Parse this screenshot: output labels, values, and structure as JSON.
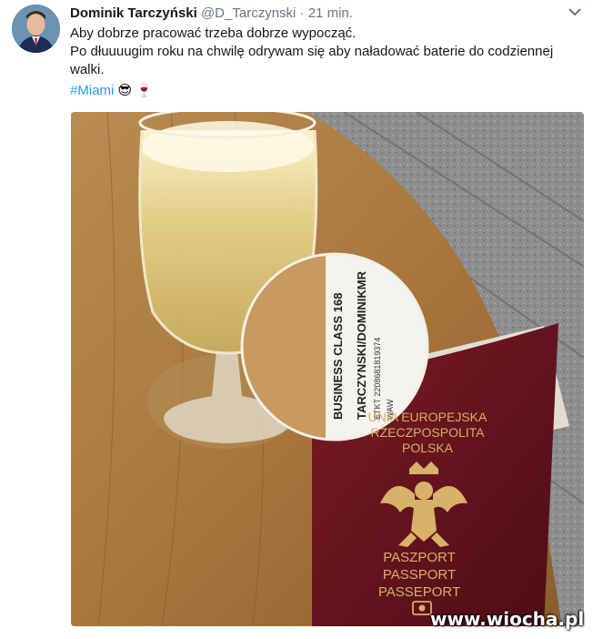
{
  "tweet": {
    "author_name": "Dominik Tarczyński",
    "handle": "@D_Tarczynski",
    "separator": "·",
    "time": "21 min.",
    "text_lines": [
      "Aby dobrze pracować trzeba dobrze wypocząć.",
      "Po dłuuuugim roku na chwilę odrywam się aby naładować baterie do codziennej",
      "walki."
    ],
    "hashtag": "#Miami",
    "emojis": [
      "sunglasses-face-emoji",
      "wine-glass-emoji"
    ]
  },
  "photo": {
    "boarding_pass": {
      "class_line": "BUSINESS CLASS 168",
      "passenger": "TARCZYNSKI/DOMINIKMR",
      "ticket": "ETKT 2208681819374",
      "code": "WAW"
    },
    "passport": {
      "header_lines": [
        "UNIA EUROPEJSKA",
        "RZECZPOSPOLITA",
        "POLSKA"
      ],
      "title_lines": [
        "PASZPORT",
        "PASSPORT",
        "PASSEPORT"
      ]
    }
  },
  "watermark": "www.wiocha.pl",
  "colors": {
    "link": "#1da1f2",
    "text": "#14171a",
    "muted": "#657786",
    "passport": "#6e1520",
    "gold": "#d8b16a"
  }
}
